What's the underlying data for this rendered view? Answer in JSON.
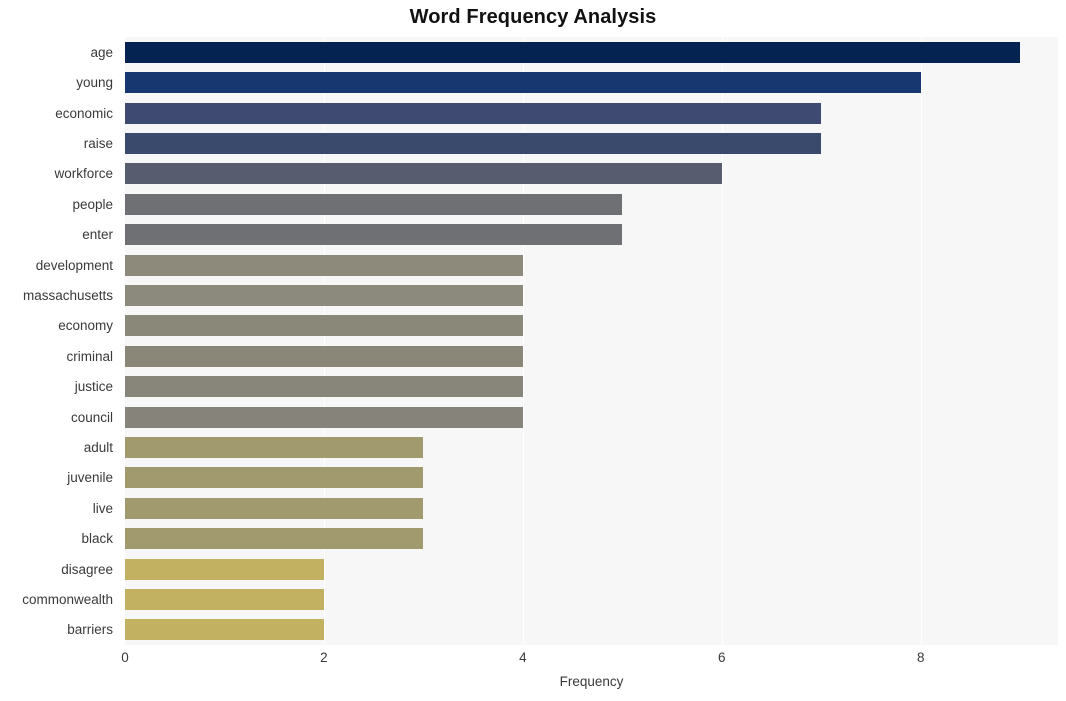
{
  "chart_data": {
    "type": "bar",
    "orientation": "horizontal",
    "title": "Word Frequency Analysis",
    "xlabel": "Frequency",
    "ylabel": "",
    "xlim": [
      0,
      9.38
    ],
    "xticks": [
      0,
      2,
      4,
      6,
      8
    ],
    "xtick_labels": [
      "0",
      "2",
      "4",
      "6",
      "8"
    ],
    "grid": true,
    "grid_axis": "x",
    "legend": false,
    "plot_background": "#f7f7f7",
    "figure_background": "#ffffff",
    "categories": [
      "age",
      "young",
      "economic",
      "raise",
      "workforce",
      "people",
      "enter",
      "development",
      "massachusetts",
      "economy",
      "criminal",
      "justice",
      "council",
      "adult",
      "juvenile",
      "live",
      "black",
      "disagree",
      "commonwealth",
      "barriers"
    ],
    "values": [
      9,
      8,
      7,
      7,
      6,
      5,
      5,
      4,
      4,
      4,
      4,
      4,
      4,
      3,
      3,
      3,
      3,
      2,
      2,
      2
    ],
    "bar_colors": [
      "#052350",
      "#173770",
      "#3f4a72",
      "#3a4a6d",
      "#575c6e",
      "#6e7073",
      "#6e7073",
      "#8d8a7c",
      "#8b8a7d",
      "#8a8879",
      "#8a8778",
      "#88867a",
      "#86847a",
      "#a29a6f",
      "#a29a6f",
      "#a29a6f",
      "#a29a6f",
      "#c2b161",
      "#c2b161",
      "#c2b161"
    ]
  }
}
